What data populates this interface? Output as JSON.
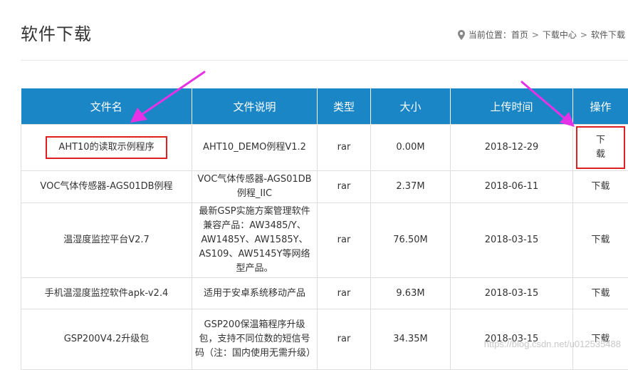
{
  "page": {
    "title": "软件下载"
  },
  "breadcrumb": {
    "prefix": "当前位置：",
    "items": [
      "首页",
      "下载中心",
      "软件下载"
    ],
    "separator": ">"
  },
  "table": {
    "headers": [
      "文件名",
      "文件说明",
      "类型",
      "大小",
      "上传时间",
      "操作"
    ],
    "rows": [
      {
        "name": "AHT10的读取示例程序",
        "desc": "AHT10_DEMO例程V1.2",
        "type": "rar",
        "size": "0.00M",
        "date": "2018-12-29",
        "action": "下载"
      },
      {
        "name": "VOC气体传感器-AGS01DB例程",
        "desc": "VOC气体传感器-AGS01DB例程_IIC",
        "type": "rar",
        "size": "2.37M",
        "date": "2018-06-11",
        "action": "下载"
      },
      {
        "name": "温湿度监控平台V2.7",
        "desc": "最新GSP实施方案管理软件兼容产品：AW3485/Y、AW1485Y、AW1585Y、AS109、AW5145Y等网络型产品。",
        "type": "rar",
        "size": "76.50M",
        "date": "2018-03-15",
        "action": "下载"
      },
      {
        "name": "手机温湿度监控软件apk-v2.4",
        "desc": "适用于安卓系统移动产品",
        "type": "rar",
        "size": "9.63M",
        "date": "2018-03-15",
        "action": "下载"
      },
      {
        "name": "GSP200V4.2升级包",
        "desc": "GSP200保温箱程序升级包，支持不同位数的短信号码（注：国内使用无需升级）",
        "type": "rar",
        "size": "34.35M",
        "date": "2018-03-15",
        "action": "下载"
      }
    ]
  },
  "annotations": {
    "arrow_color": "#e632e6",
    "highlight_color": "#e02020"
  },
  "watermark": "https://blog.csdn.net/u012535488",
  "colors": {
    "header_bg": "#1a86c6"
  }
}
